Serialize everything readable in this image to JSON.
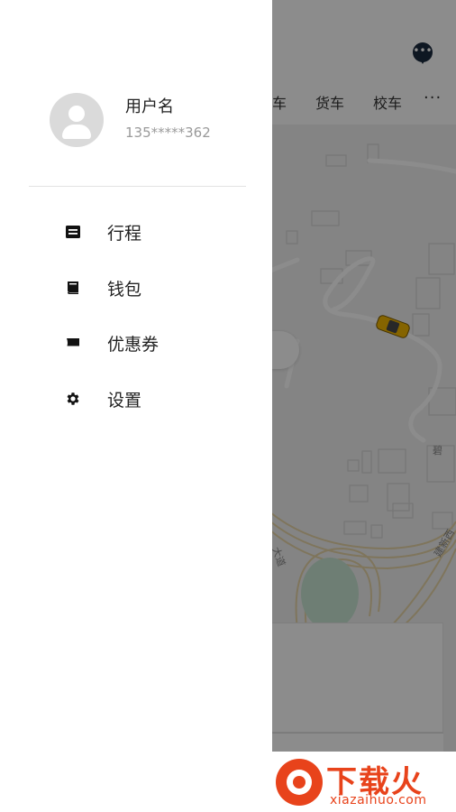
{
  "background": {
    "tabs": [
      "车",
      "货车",
      "校车"
    ],
    "more": "···",
    "message_icon": "chat-bubble-icon",
    "map_labels": [
      "建新西",
      "大道",
      "碧"
    ]
  },
  "drawer": {
    "user": {
      "name": "用户名",
      "phone": "135*****362",
      "avatar_icon": "default-avatar-icon"
    },
    "menu": [
      {
        "label": "行程",
        "icon": "trip-list-icon"
      },
      {
        "label": "钱包",
        "icon": "wallet-book-icon"
      },
      {
        "label": "优惠券",
        "icon": "coupon-ticket-icon"
      },
      {
        "label": "设置",
        "icon": "gear-icon"
      }
    ]
  },
  "watermark": {
    "title": "下载火",
    "subtitle": "xiazaihuo.com"
  },
  "colors": {
    "accent": "#e8431b",
    "dim_overlay": "rgba(0,0,0,0.45)",
    "taxi": "#f2b600"
  }
}
